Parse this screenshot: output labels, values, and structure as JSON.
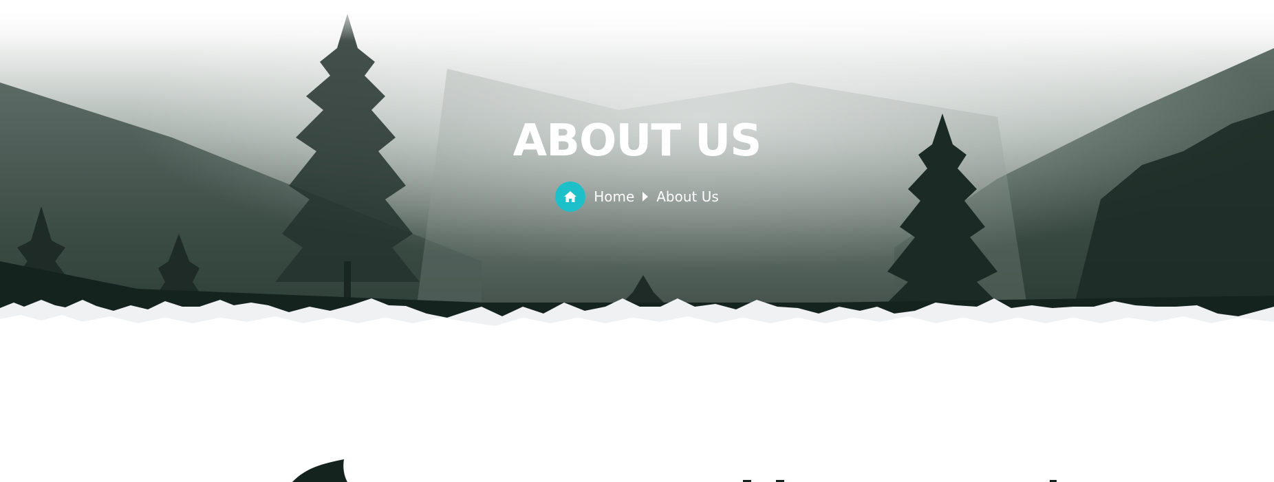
{
  "hero": {
    "title": "ABOUT US",
    "background": "misty-forest-mountains"
  },
  "breadcrumb": {
    "home_icon": "home-icon",
    "home_label": "Home",
    "separator_icon": "caret-right-icon",
    "current_label": "About Us"
  },
  "colors": {
    "accent": "#1dc0c9",
    "forest_dark": "#1a2a25",
    "snow": "#ffffff"
  }
}
